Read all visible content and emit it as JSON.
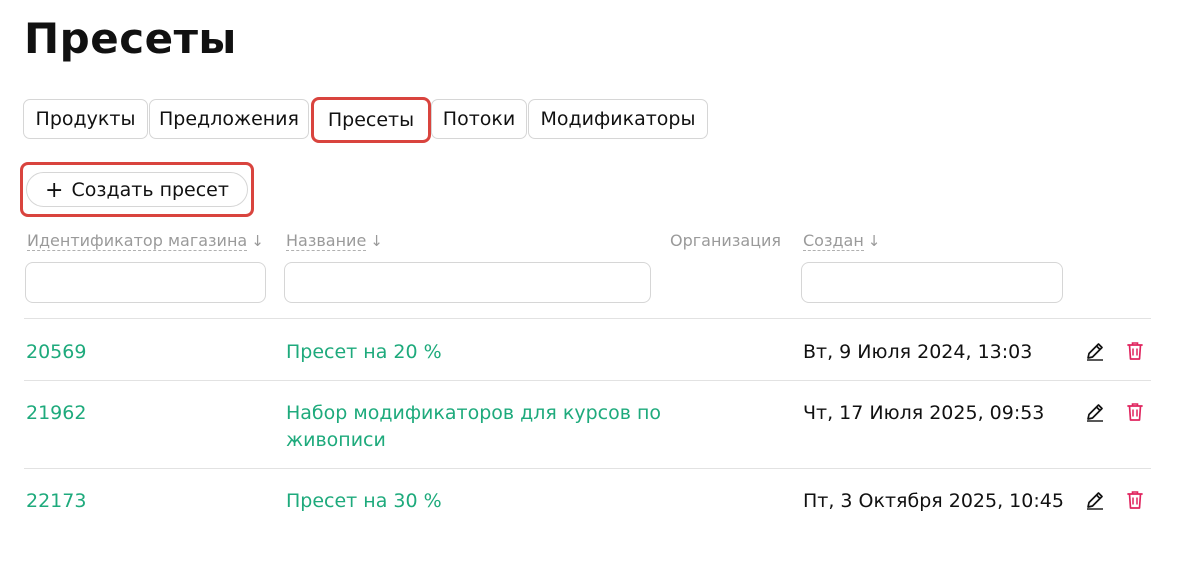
{
  "page": {
    "title": "Пресеты"
  },
  "tabs": [
    {
      "label": "Продукты",
      "active": false
    },
    {
      "label": "Предложения",
      "active": false
    },
    {
      "label": "Пресеты",
      "active": true
    },
    {
      "label": "Потоки",
      "active": false
    },
    {
      "label": "Модификаторы",
      "active": false
    }
  ],
  "toolbar": {
    "create_label": "Создать пресет",
    "create_icon": "plus-icon"
  },
  "table": {
    "columns": [
      {
        "label": "Идентификатор магазина",
        "sortable": true,
        "sort_direction": "down"
      },
      {
        "label": "Название",
        "sortable": true,
        "sort_direction": "down"
      },
      {
        "label": "Организация",
        "sortable": false
      },
      {
        "label": "Создан",
        "sortable": true,
        "sort_direction": "down"
      }
    ],
    "filters": {
      "shop_id": "",
      "name": "",
      "created": ""
    },
    "rows": [
      {
        "id": "20569",
        "name": "Пресет на 20 %",
        "organization": "",
        "created": "Вт, 9 Июля 2024, 13:03"
      },
      {
        "id": "21962",
        "name": "Набор модификаторов для курсов по живописи",
        "organization": "",
        "created": "Чт, 17 Июля 2025, 09:53"
      },
      {
        "id": "22173",
        "name": "Пресет на 30 %",
        "organization": "",
        "created": "Пт, 3 Октября 2025, 10:45"
      }
    ],
    "row_actions": {
      "edit_icon": "pencil-icon",
      "delete_icon": "trash-icon"
    }
  },
  "colors": {
    "link_green": "#1eaa7c",
    "delete_red": "#e0245e",
    "highlight_red": "#d9443e",
    "header_gray": "#9a9a9a",
    "border_gray": "#d6d6d6"
  }
}
